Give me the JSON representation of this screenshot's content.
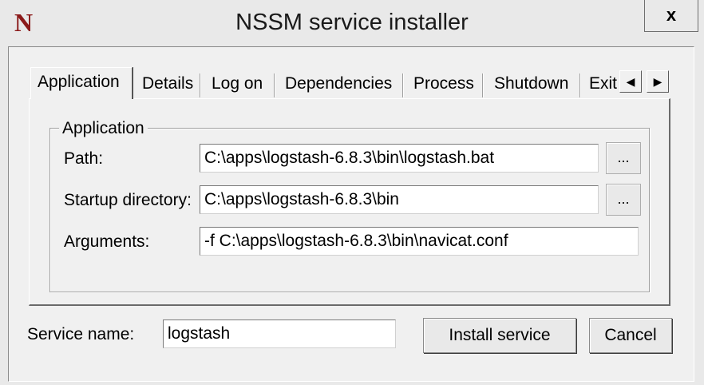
{
  "window": {
    "title": "NSSM service installer",
    "icon_letter": "N",
    "close_label": "x"
  },
  "tabs": [
    {
      "label": "Application",
      "active": true
    },
    {
      "label": "Details"
    },
    {
      "label": "Log on"
    },
    {
      "label": "Dependencies"
    },
    {
      "label": "Process"
    },
    {
      "label": "Shutdown"
    },
    {
      "label": "Exit"
    }
  ],
  "tab_scroll": {
    "left": "◀",
    "right": "▶"
  },
  "application": {
    "group_label": "Application",
    "path": {
      "label": "Path:",
      "value": "C:\\apps\\logstash-6.8.3\\bin\\logstash.bat",
      "browse": "..."
    },
    "startup_directory": {
      "label": "Startup directory:",
      "value": "C:\\apps\\logstash-6.8.3\\bin",
      "browse": "..."
    },
    "arguments": {
      "label": "Arguments:",
      "value": "-f C:\\apps\\logstash-6.8.3\\bin\\navicat.conf"
    }
  },
  "service": {
    "label": "Service name:",
    "value": "logstash"
  },
  "buttons": {
    "install": "Install service",
    "cancel": "Cancel"
  }
}
